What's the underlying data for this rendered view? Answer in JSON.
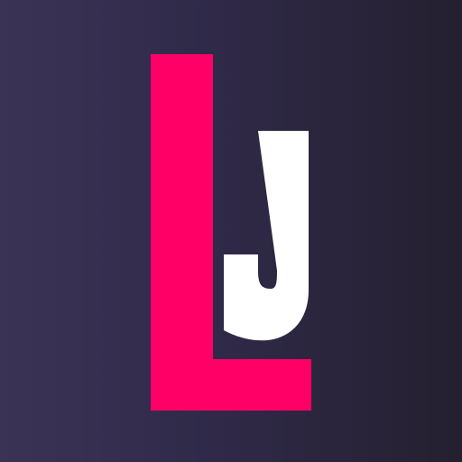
{
  "logo": {
    "text": "LJ",
    "letters": [
      "L",
      "J"
    ],
    "colors": {
      "background_left": "#3b3356",
      "background_right": "#24202f",
      "l_color": "#ff0066",
      "j_color": "#ffffff"
    }
  }
}
